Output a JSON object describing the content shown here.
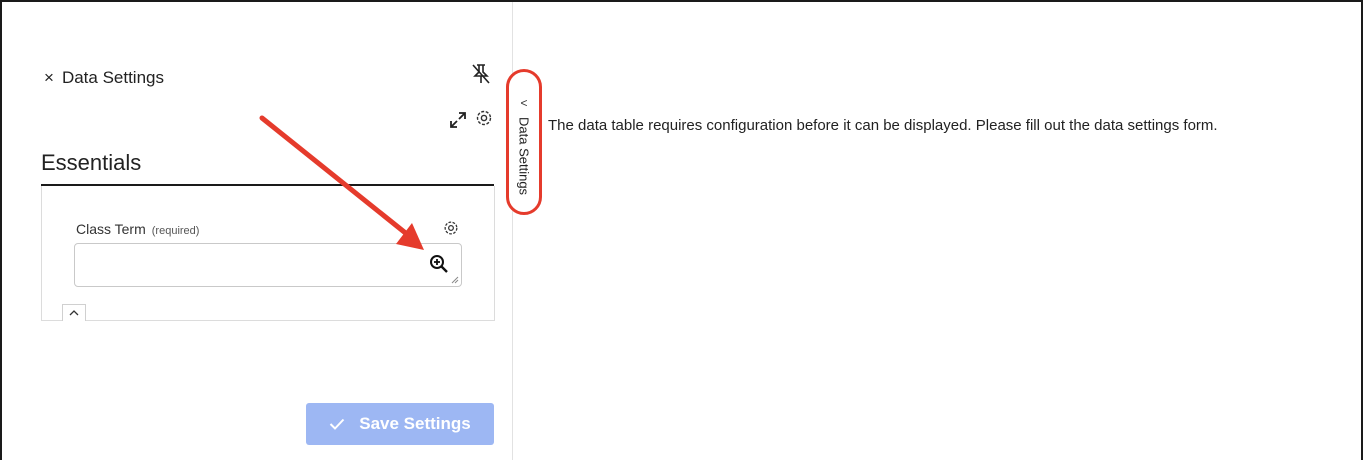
{
  "panel": {
    "close_label": "×",
    "title": "Data Settings",
    "section_title": "Essentials",
    "field": {
      "label": "Class Term",
      "required_note": "(required)",
      "value": ""
    },
    "save_label": "Save Settings"
  },
  "side_tab": {
    "label": "Data Settings",
    "chevron": "<"
  },
  "message": "The data table requires configuration before it can be displayed. Please fill out the data settings form.",
  "icons": [
    "close-icon",
    "unpin-icon",
    "expand-icon",
    "gear-icon",
    "zoom-in-icon",
    "chevron-up-icon",
    "check-icon",
    "chevron-left-icon"
  ],
  "colors": {
    "annotation": "#e53b2c",
    "button_disabled": "#9db7f3"
  }
}
